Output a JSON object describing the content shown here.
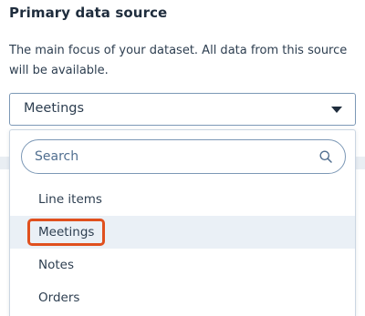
{
  "section": {
    "title": "Primary data source",
    "description": "The main focus of your dataset. All data from this source will be available."
  },
  "select": {
    "value": "Meetings",
    "icon": "caret-down-icon"
  },
  "dropdown": {
    "search": {
      "placeholder": "Search",
      "icon": "search-icon"
    },
    "options": [
      {
        "label": "Line items",
        "selected": false
      },
      {
        "label": "Meetings",
        "selected": true
      },
      {
        "label": "Notes",
        "selected": false
      },
      {
        "label": "Orders",
        "selected": false
      }
    ],
    "highlight_color": "#e0501e"
  }
}
